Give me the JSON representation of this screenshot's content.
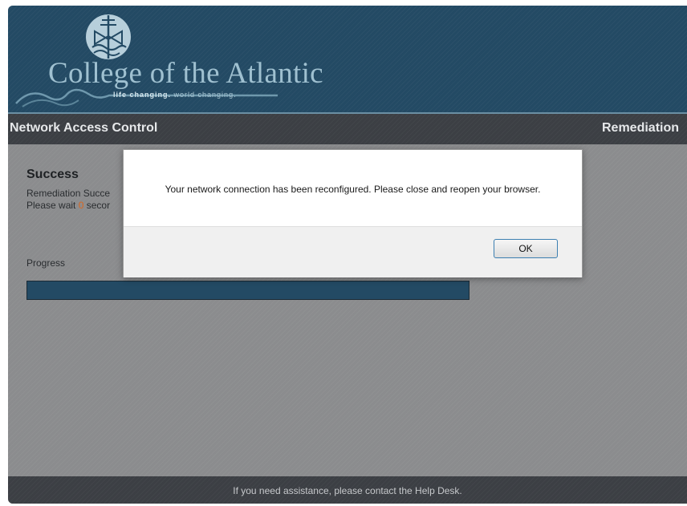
{
  "logo": {
    "name": "College of the Atlantic",
    "tagline_bold": "life changing.",
    "tagline_rest": "world changing."
  },
  "navbar": {
    "title": "Network Access Control",
    "right_label": "Remediation"
  },
  "status": {
    "heading": "Success",
    "line1": "Remediation Succe",
    "line2_prefix": "Please wait ",
    "line2_count": "0",
    "line2_suffix": " secor"
  },
  "progress": {
    "label": "Progress",
    "fraction": 1.0
  },
  "dialog": {
    "message": "Your network connection has been reconfigured. Please close and reopen your browser.",
    "ok_label": "OK"
  },
  "footer": {
    "text": "If you need assistance, please contact the Help Desk."
  },
  "colors": {
    "header": "#234a64",
    "navbar": "#3c3f44",
    "countdown": "#d9651e",
    "progress_fill": "#234a64"
  }
}
